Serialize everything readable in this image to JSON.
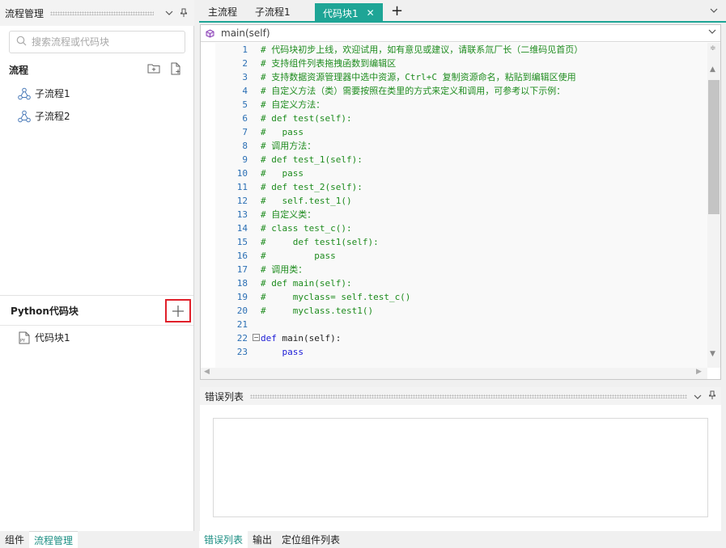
{
  "left_panel": {
    "title": "流程管理",
    "search_placeholder": "搜索流程或代码块",
    "flow_section": "流程",
    "flows": [
      {
        "label": "子流程1"
      },
      {
        "label": "子流程2"
      }
    ],
    "python_section": "Python代码块",
    "code_blocks": [
      {
        "label": "代码块1"
      }
    ],
    "tabs": [
      "组件",
      "流程管理"
    ]
  },
  "editor": {
    "tabs": [
      "主流程",
      "子流程1",
      "代码块1"
    ],
    "active_tab": "代码块1",
    "function_selector": "main(self)",
    "lines": [
      {
        "n": "1",
        "text": "# 代码块初步上线，欢迎试用，如有意见或建议，请联系氚厂长（二维码见首页）",
        "type": "comment"
      },
      {
        "n": "2",
        "text": "# 支持组件列表拖拽函数到编辑区",
        "type": "comment"
      },
      {
        "n": "3",
        "text": "# 支持数据资源管理器中选中资源，Ctrl+C 复制资源命名，粘贴到编辑区使用",
        "type": "comment"
      },
      {
        "n": "4",
        "text": "# 自定义方法（类）需要按照在类里的方式来定义和调用，可参考以下示例：",
        "type": "comment"
      },
      {
        "n": "5",
        "text": "# 自定义方法：",
        "type": "comment"
      },
      {
        "n": "6",
        "text": "# def test(self):",
        "type": "comment"
      },
      {
        "n": "7",
        "text": "#   pass",
        "type": "comment"
      },
      {
        "n": "8",
        "text": "# 调用方法：",
        "type": "comment"
      },
      {
        "n": "9",
        "text": "# def test_1(self):",
        "type": "comment"
      },
      {
        "n": "10",
        "text": "#   pass",
        "type": "comment"
      },
      {
        "n": "11",
        "text": "# def test_2(self):",
        "type": "comment"
      },
      {
        "n": "12",
        "text": "#   self.test_1()",
        "type": "comment"
      },
      {
        "n": "13",
        "text": "# 自定义类：",
        "type": "comment"
      },
      {
        "n": "14",
        "text": "# class test_c():",
        "type": "comment"
      },
      {
        "n": "15",
        "text": "#     def test1(self):",
        "type": "comment"
      },
      {
        "n": "16",
        "text": "#         pass",
        "type": "comment"
      },
      {
        "n": "17",
        "text": "# 调用类：",
        "type": "comment"
      },
      {
        "n": "18",
        "text": "# def main(self):",
        "type": "comment"
      },
      {
        "n": "19",
        "text": "#     myclass= self.test_c()",
        "type": "comment"
      },
      {
        "n": "20",
        "text": "#     myclass.test1()",
        "type": "comment"
      },
      {
        "n": "21",
        "text": "",
        "type": "code"
      },
      {
        "n": "22",
        "kw": "def",
        "text": " main(self):",
        "type": "code"
      },
      {
        "n": "23",
        "text": "    ",
        "kw2": "pass",
        "type": "code"
      }
    ]
  },
  "error_panel": {
    "title": "错误列表",
    "tabs": [
      "错误列表",
      "输出",
      "定位组件列表"
    ]
  },
  "colors": {
    "accent": "#1ea596",
    "comment": "#1e8c1e",
    "keyword": "#1a1ad6",
    "line_number": "#2b6fb4",
    "highlight_border": "#e0202a"
  }
}
